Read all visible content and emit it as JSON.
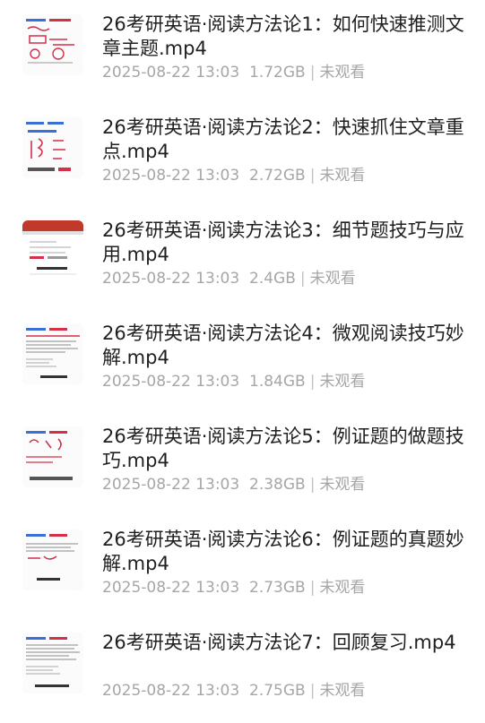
{
  "videos": [
    {
      "title": "26考研英语·阅读方法论1：如何快速推测文章主题.mp4",
      "date": "2025-08-22 13:03",
      "size": "1.72GB",
      "status": "未观看",
      "thumb_icon": "lecture-slide-thumbnail"
    },
    {
      "title": "26考研英语·阅读方法论2：快速抓住文章重点.mp4",
      "date": "2025-08-22 13:03",
      "size": "2.72GB",
      "status": "未观看",
      "thumb_icon": "lecture-slide-thumbnail"
    },
    {
      "title": "26考研英语·阅读方法论3：细节题技巧与应用.mp4",
      "date": "2025-08-22 13:03",
      "size": "2.4GB",
      "status": "未观看",
      "thumb_icon": "document-screen-thumbnail"
    },
    {
      "title": "26考研英语·阅读方法论4：微观阅读技巧妙解.mp4",
      "date": "2025-08-22 13:03",
      "size": "1.84GB",
      "status": "未观看",
      "thumb_icon": "lecture-slide-thumbnail"
    },
    {
      "title": "26考研英语·阅读方法论5：例证题的做题技巧.mp4",
      "date": "2025-08-22 13:03",
      "size": "2.38GB",
      "status": "未观看",
      "thumb_icon": "lecture-slide-thumbnail"
    },
    {
      "title": "26考研英语·阅读方法论6：例证题的真题妙解.mp4",
      "date": "2025-08-22 13:03",
      "size": "2.73GB",
      "status": "未观看",
      "thumb_icon": "lecture-slide-thumbnail"
    },
    {
      "title": "26考研英语·阅读方法论7：回顾复习.mp4",
      "date": "2025-08-22 13:03",
      "size": "2.75GB",
      "status": "未观看",
      "thumb_icon": "lecture-slide-thumbnail"
    }
  ],
  "separator": "|",
  "colors": {
    "title": "#1f1f1f",
    "meta": "#a6a6a6",
    "thumb_ink": "#d3304a",
    "thumb_blue": "#3a6fd8"
  }
}
